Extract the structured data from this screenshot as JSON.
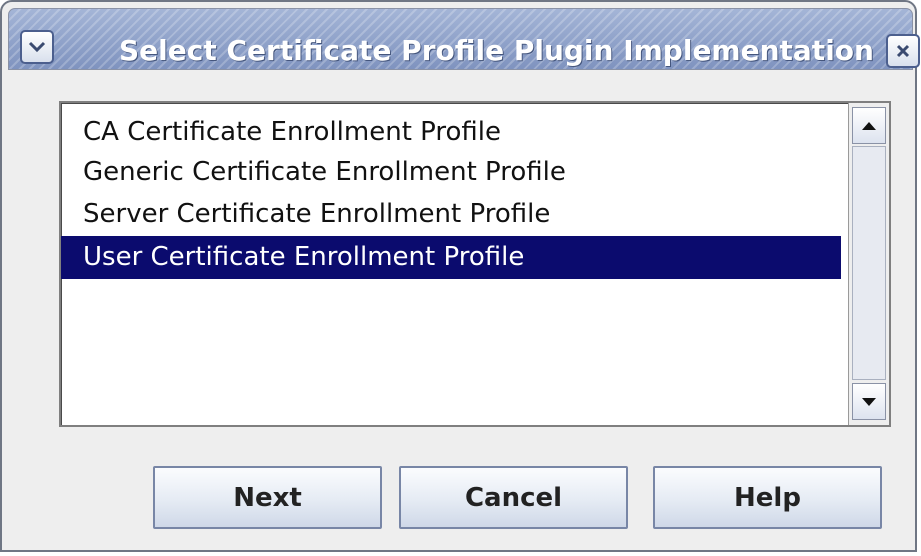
{
  "window": {
    "title": "Select Certificate Profile Plugin Implementation"
  },
  "icons": {
    "menu": "chevron-down-icon",
    "close": "close-icon",
    "scroll_up": "arrow-up-icon",
    "scroll_down": "arrow-down-icon"
  },
  "list": {
    "items": [
      {
        "label": "CA Certificate Enrollment Profile"
      },
      {
        "label": "Generic Certificate Enrollment Profile"
      },
      {
        "label": "Server Certificate Enrollment Profile"
      },
      {
        "label": "User Certificate Enrollment Profile"
      }
    ],
    "selected_index": 3
  },
  "buttons": {
    "next": "Next",
    "cancel": "Cancel",
    "help": "Help"
  },
  "colors": {
    "selection_bg": "#0b0b6e",
    "titlebar": "#8a9bc7"
  }
}
